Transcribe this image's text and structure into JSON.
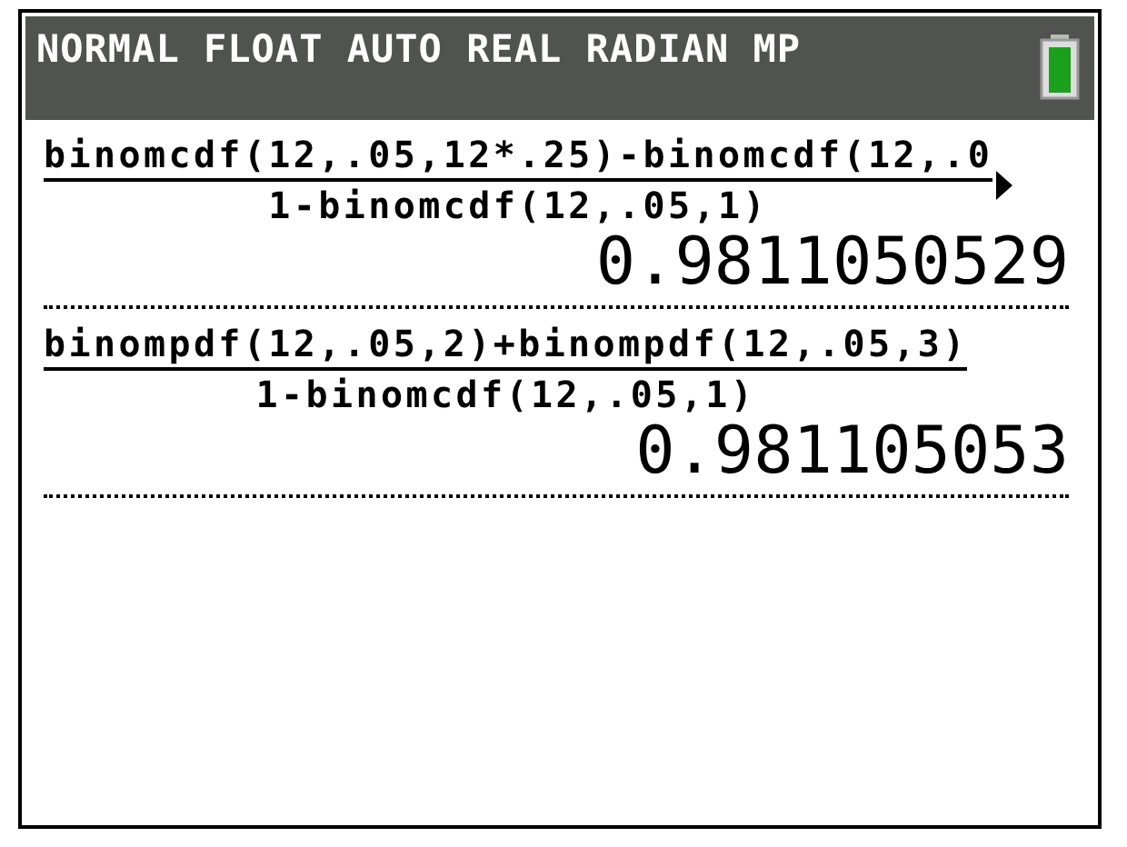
{
  "status_bar": {
    "modes": "NORMAL FLOAT AUTO REAL RADIAN MP"
  },
  "entries": [
    {
      "numerator": "binomcdf(12,.05,12*.25)-binomcdf(12,.0",
      "denominator": "1-binomcdf(12,.05,1)",
      "result": "0.9811050529",
      "truncated": true
    },
    {
      "numerator": "binompdf(12,.05,2)+binompdf(12,.05,3)",
      "denominator": "1-binomcdf(12,.05,1)",
      "result": "0.981105053",
      "truncated": false
    }
  ]
}
